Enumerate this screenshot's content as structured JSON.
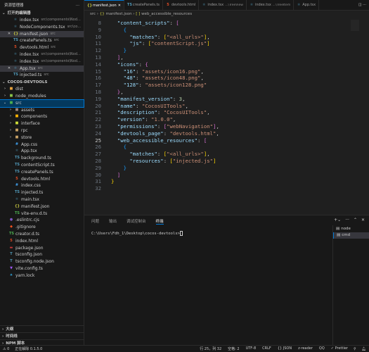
{
  "sidebar": {
    "title": "资源管理器",
    "more": "···",
    "open_editors": {
      "label": "打开的编辑器",
      "items": [
        {
          "name": "index.tsx",
          "desc": "src\\components\\NodeTree",
          "icon": "react-icon",
          "close": false
        },
        {
          "name": "NodeComponents.tsx",
          "desc": "src\\compone...",
          "icon": "react-icon",
          "close": false
        },
        {
          "name": "manifest.json",
          "desc": "src",
          "icon": "json-icon",
          "close": true,
          "selected": true
        },
        {
          "name": "createPanels.ts",
          "desc": "src",
          "icon": "ts-icon",
          "close": false
        },
        {
          "name": "devtools.html",
          "desc": "src",
          "icon": "html-icon",
          "close": false
        },
        {
          "name": "index.tsx",
          "desc": "src\\components\\NodeTree\\...",
          "icon": "react-icon",
          "close": false
        },
        {
          "name": "index.tsx",
          "desc": "src\\components\\NodeTree\\...",
          "icon": "react-icon",
          "close": false
        },
        {
          "name": "App.tsx",
          "desc": "src",
          "icon": "react-icon",
          "close": true,
          "selected": true
        },
        {
          "name": "injected.ts",
          "desc": "src",
          "icon": "ts-icon",
          "close": false
        }
      ]
    },
    "project": {
      "label": "COCOS-DEVTOOLS",
      "tree": [
        {
          "name": "dist",
          "depth": 0,
          "folder": true,
          "color": "#e8a33d"
        },
        {
          "name": "node_modules",
          "depth": 0,
          "folder": true,
          "color": "#8bc34a"
        },
        {
          "name": "src",
          "depth": 0,
          "folder": true,
          "open": true,
          "color": "#4caf50",
          "active": true
        },
        {
          "name": "assets",
          "depth": 1,
          "folder": true,
          "color": "#a1887f"
        },
        {
          "name": "components",
          "depth": 1,
          "folder": true,
          "color": "#ffb300"
        },
        {
          "name": "interface",
          "depth": 1,
          "folder": true,
          "color": "#cddc39"
        },
        {
          "name": "rpc",
          "depth": 1,
          "folder": true,
          "color": "#c8a165"
        },
        {
          "name": "store",
          "depth": 1,
          "folder": true,
          "color": "#c8a165"
        },
        {
          "name": "App.css",
          "depth": 1,
          "icon": "css-icon"
        },
        {
          "name": "App.tsx",
          "depth": 1,
          "icon": "react-icon"
        },
        {
          "name": "background.ts",
          "depth": 1,
          "icon": "ts-icon"
        },
        {
          "name": "contentScript.ts",
          "depth": 1,
          "icon": "ts-icon"
        },
        {
          "name": "createPanels.ts",
          "depth": 1,
          "icon": "ts-icon"
        },
        {
          "name": "devtools.html",
          "depth": 1,
          "icon": "html-icon"
        },
        {
          "name": "index.css",
          "depth": 1,
          "icon": "css-icon"
        },
        {
          "name": "injected.ts",
          "depth": 1,
          "icon": "ts-icon"
        },
        {
          "name": "main.tsx",
          "depth": 1,
          "icon": "react-icon"
        },
        {
          "name": "manifest.json",
          "depth": 1,
          "icon": "json-icon"
        },
        {
          "name": "vite-env.d.ts",
          "depth": 1,
          "icon": "dts-icon"
        },
        {
          "name": ".eslintrc.cjs",
          "depth": 0,
          "icon": "eslint-icon"
        },
        {
          "name": ".gitignore",
          "depth": 0,
          "icon": "git-icon"
        },
        {
          "name": "creator.d.ts",
          "depth": 0,
          "icon": "dts-icon"
        },
        {
          "name": "index.html",
          "depth": 0,
          "icon": "html-icon"
        },
        {
          "name": "package.json",
          "depth": 0,
          "icon": "npm-icon"
        },
        {
          "name": "tsconfig.json",
          "depth": 0,
          "icon": "tsconfig-icon"
        },
        {
          "name": "tsconfig.node.json",
          "depth": 0,
          "icon": "tsconfig-icon"
        },
        {
          "name": "vite.config.ts",
          "depth": 0,
          "icon": "vite-icon"
        },
        {
          "name": "yarn.lock",
          "depth": 0,
          "icon": "yarn-icon"
        }
      ]
    },
    "bottom_sections": [
      "大纲",
      "时间线",
      "NPM 脚本"
    ]
  },
  "tabs": [
    {
      "label": "manifest.json",
      "icon": "json-icon",
      "active": true
    },
    {
      "label": "createPanels.ts",
      "icon": "ts-icon"
    },
    {
      "label": "devtools.html",
      "icon": "html-icon"
    },
    {
      "label": "index.tsx",
      "desc": "...\\TreeView",
      "icon": "react-icon"
    },
    {
      "label": "index.tsx",
      "desc": "...\\TreeItem",
      "icon": "react-icon"
    },
    {
      "label": "App.tsx",
      "icon": "react-icon"
    }
  ],
  "breadcrumb": {
    "folder": "src",
    "file": "manifest.json",
    "symbol": "web_accessible_resources"
  },
  "editor": {
    "current_line": 25,
    "lines": [
      [
        8,
        [
          [
            "p",
            "  "
          ],
          [
            "k",
            "\"content_scripts\""
          ],
          [
            "p",
            ": "
          ],
          [
            "b1",
            "["
          ]
        ]
      ],
      [
        9,
        [
          [
            "p",
            "    "
          ],
          [
            "b2",
            "{"
          ]
        ]
      ],
      [
        10,
        [
          [
            "p",
            "      "
          ],
          [
            "k",
            "\"matches\""
          ],
          [
            "p",
            ": "
          ],
          [
            "b3",
            "["
          ],
          [
            "s",
            "\"<all_urls>\""
          ],
          [
            "b3",
            "]"
          ],
          [
            "p",
            ","
          ]
        ]
      ],
      [
        11,
        [
          [
            "p",
            "      "
          ],
          [
            "k",
            "\"js\""
          ],
          [
            "p",
            ": "
          ],
          [
            "b3",
            "["
          ],
          [
            "s",
            "\"contentScript.js\""
          ],
          [
            "b3",
            "]"
          ]
        ]
      ],
      [
        12,
        [
          [
            "p",
            "    "
          ],
          [
            "b2",
            "}"
          ]
        ]
      ],
      [
        13,
        [
          [
            "p",
            "  "
          ],
          [
            "b1",
            "]"
          ],
          [
            "p",
            ","
          ]
        ]
      ],
      [
        14,
        [
          [
            "p",
            "  "
          ],
          [
            "k",
            "\"icons\""
          ],
          [
            "p",
            ": "
          ],
          [
            "b1",
            "{"
          ]
        ]
      ],
      [
        15,
        [
          [
            "p",
            "    "
          ],
          [
            "k",
            "\"16\""
          ],
          [
            "p",
            ": "
          ],
          [
            "s",
            "\"assets/icon16.png\""
          ],
          [
            "p",
            ","
          ]
        ]
      ],
      [
        16,
        [
          [
            "p",
            "    "
          ],
          [
            "k",
            "\"48\""
          ],
          [
            "p",
            ": "
          ],
          [
            "s",
            "\"assets/icon48.png\""
          ],
          [
            "p",
            ","
          ]
        ]
      ],
      [
        17,
        [
          [
            "p",
            "    "
          ],
          [
            "k",
            "\"128\""
          ],
          [
            "p",
            ": "
          ],
          [
            "s",
            "\"assets/icon128.png\""
          ]
        ]
      ],
      [
        18,
        [
          [
            "p",
            "  "
          ],
          [
            "b1",
            "}"
          ],
          [
            "p",
            ","
          ]
        ]
      ],
      [
        19,
        [
          [
            "p",
            "  "
          ],
          [
            "k",
            "\"manifest_version\""
          ],
          [
            "p",
            ": "
          ],
          [
            "n",
            "3"
          ],
          [
            "p",
            ","
          ]
        ]
      ],
      [
        20,
        [
          [
            "p",
            "  "
          ],
          [
            "k",
            "\"name\""
          ],
          [
            "p",
            ": "
          ],
          [
            "s",
            "\"CocosUITools\""
          ],
          [
            "p",
            ","
          ]
        ]
      ],
      [
        21,
        [
          [
            "p",
            "  "
          ],
          [
            "k",
            "\"description\""
          ],
          [
            "p",
            ": "
          ],
          [
            "s",
            "\"CocosUITools\""
          ],
          [
            "p",
            ","
          ]
        ]
      ],
      [
        22,
        [
          [
            "p",
            "  "
          ],
          [
            "k",
            "\"version\""
          ],
          [
            "p",
            ": "
          ],
          [
            "s",
            "\"1.0.0\""
          ],
          [
            "p",
            ","
          ]
        ]
      ],
      [
        23,
        [
          [
            "p",
            "  "
          ],
          [
            "k",
            "\"permissions\""
          ],
          [
            "p",
            ": "
          ],
          [
            "b1",
            "["
          ],
          [
            "s",
            "\"webNavigation\""
          ],
          [
            "b1",
            "]"
          ],
          [
            "p",
            ","
          ]
        ]
      ],
      [
        24,
        [
          [
            "p",
            "  "
          ],
          [
            "k",
            "\"devtools_page\""
          ],
          [
            "p",
            ": "
          ],
          [
            "s",
            "\"devtools.html\""
          ],
          [
            "p",
            ","
          ]
        ]
      ],
      [
        25,
        [
          [
            "p",
            "  "
          ],
          [
            "k",
            "\"web_accessible_resources\""
          ],
          [
            "p",
            ": "
          ],
          [
            "b1",
            "["
          ]
        ]
      ],
      [
        26,
        [
          [
            "p",
            "    "
          ],
          [
            "b2",
            "{"
          ]
        ]
      ],
      [
        27,
        [
          [
            "p",
            "      "
          ],
          [
            "k",
            "\"matches\""
          ],
          [
            "p",
            ": "
          ],
          [
            "b3",
            "["
          ],
          [
            "s",
            "\"<all_urls>\""
          ],
          [
            "b3",
            "]"
          ],
          [
            "p",
            ","
          ]
        ]
      ],
      [
        28,
        [
          [
            "p",
            "      "
          ],
          [
            "k",
            "\"resources\""
          ],
          [
            "p",
            ": "
          ],
          [
            "b3",
            "["
          ],
          [
            "s",
            "\"injected.js\""
          ],
          [
            "b3",
            "]"
          ]
        ]
      ],
      [
        29,
        [
          [
            "p",
            "    "
          ],
          [
            "b2",
            "}"
          ]
        ]
      ],
      [
        30,
        [
          [
            "p",
            "  "
          ],
          [
            "b1",
            "]"
          ]
        ]
      ],
      [
        31,
        [
          [
            "b3",
            "}"
          ]
        ]
      ],
      [
        32,
        []
      ]
    ]
  },
  "panel": {
    "tabs": [
      "问题",
      "输出",
      "调试控制台",
      "终端"
    ],
    "active": 3,
    "prompt": "C:\\Users\\Fdh_1\\Desktop\\cocos-devtools>",
    "terminals": [
      "node",
      "cmd"
    ],
    "active_terminal": 1
  },
  "status": {
    "left": [
      "⚠ 0",
      "正在解除 0.1.5.0"
    ],
    "right": [
      "行 25，列 32",
      "空格: 2",
      "UTF-8",
      "CRLF",
      "{} JSON",
      "z-reader",
      "QQ",
      "✓ Prettier"
    ]
  }
}
